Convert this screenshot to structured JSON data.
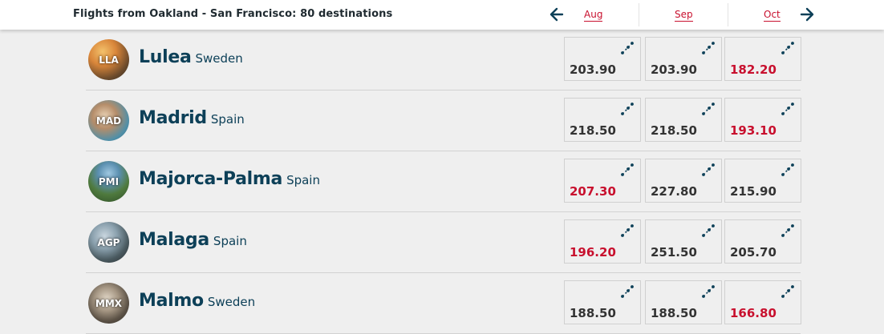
{
  "header": {
    "title": "Flights from Oakland - San Francisco: 80 destinations",
    "months": [
      "Aug",
      "Sep",
      "Oct"
    ],
    "prev_icon": "arrow-left-icon",
    "next_icon": "arrow-right-icon"
  },
  "colors": {
    "accent_red": "#c8102e",
    "navy": "#0d4058",
    "background": "#efefef"
  },
  "destinations": [
    {
      "code": "LLA",
      "city": "Lulea",
      "country": "Sweden",
      "prices": [
        {
          "value": "203.90",
          "lowest": false
        },
        {
          "value": "203.90",
          "lowest": false
        },
        {
          "value": "182.20",
          "lowest": true
        }
      ]
    },
    {
      "code": "MAD",
      "city": "Madrid",
      "country": "Spain",
      "prices": [
        {
          "value": "218.50",
          "lowest": false
        },
        {
          "value": "218.50",
          "lowest": false
        },
        {
          "value": "193.10",
          "lowest": true
        }
      ]
    },
    {
      "code": "PMI",
      "city": "Majorca-Palma",
      "country": "Spain",
      "prices": [
        {
          "value": "207.30",
          "lowest": true
        },
        {
          "value": "227.80",
          "lowest": false
        },
        {
          "value": "215.90",
          "lowest": false
        }
      ]
    },
    {
      "code": "AGP",
      "city": "Malaga",
      "country": "Spain",
      "prices": [
        {
          "value": "196.20",
          "lowest": true
        },
        {
          "value": "251.50",
          "lowest": false
        },
        {
          "value": "205.70",
          "lowest": false
        }
      ]
    },
    {
      "code": "MMX",
      "city": "Malmo",
      "country": "Sweden",
      "prices": [
        {
          "value": "188.50",
          "lowest": false
        },
        {
          "value": "188.50",
          "lowest": false
        },
        {
          "value": "166.80",
          "lowest": true
        }
      ]
    }
  ]
}
